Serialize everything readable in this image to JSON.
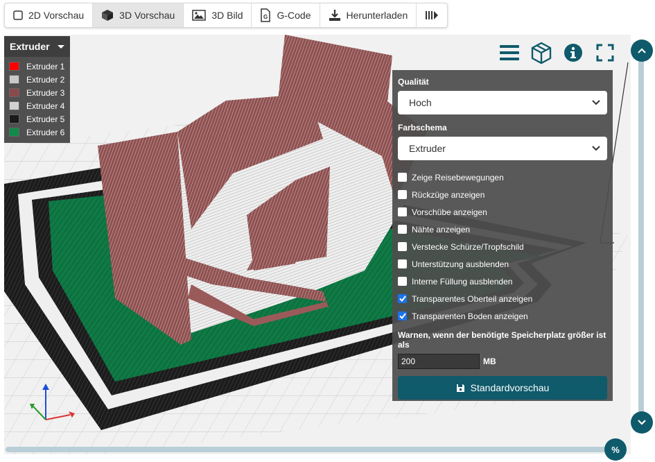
{
  "toolbar": {
    "items": [
      {
        "label": "2D Vorschau",
        "icon": "square-outline-icon",
        "active": false
      },
      {
        "label": "3D Vorschau",
        "icon": "cube-icon",
        "active": true
      },
      {
        "label": "3D Bild",
        "icon": "image-icon",
        "active": false
      },
      {
        "label": "G-Code",
        "icon": "gcode-file-icon",
        "active": false
      },
      {
        "label": "Herunterladen",
        "icon": "download-icon",
        "active": false
      },
      {
        "label": "",
        "icon": "play-bars-icon",
        "active": false
      }
    ]
  },
  "legend": {
    "title": "Extruder",
    "items": [
      {
        "label": "Extruder 1",
        "color": "#ff0000"
      },
      {
        "label": "Extruder 2",
        "color": "#c8c8c8"
      },
      {
        "label": "Extruder 3",
        "color": "#8b4a4a"
      },
      {
        "label": "Extruder 4",
        "color": "#d2d2d2"
      },
      {
        "label": "Extruder 5",
        "color": "#1a1a1a"
      },
      {
        "label": "Extruder 6",
        "color": "#0f8a4a"
      }
    ]
  },
  "panel": {
    "quality_label": "Qualität",
    "quality_value": "Hoch",
    "scheme_label": "Farbschema",
    "scheme_value": "Extruder",
    "options": [
      {
        "label": "Zeige Reisebewegungen",
        "checked": false
      },
      {
        "label": "Rückzüge anzeigen",
        "checked": false
      },
      {
        "label": "Vorschübe anzeigen",
        "checked": false
      },
      {
        "label": "Nähte anzeigen",
        "checked": false
      },
      {
        "label": "Verstecke Schürze/Tropfschild",
        "checked": false
      },
      {
        "label": "Unterstützung ausblenden",
        "checked": false
      },
      {
        "label": "Interne Füllung ausblenden",
        "checked": false
      },
      {
        "label": "Transparentes Oberteil anzeigen",
        "checked": true
      },
      {
        "label": "Transparenten Boden anzeigen",
        "checked": true
      }
    ],
    "warn_label": "Warnen, wenn der benötigte Speicherplatz größer ist als",
    "mb_value": "200",
    "mb_unit": "MB",
    "default_button": "Standardvorschau"
  },
  "zoom_label": "%",
  "colors": {
    "accent": "#0f5a6b",
    "brick": "#8b4a4a",
    "fill_green": "#0f7a45",
    "skirt_black": "#1c1c1c",
    "check_blue": "#1a73e8"
  }
}
